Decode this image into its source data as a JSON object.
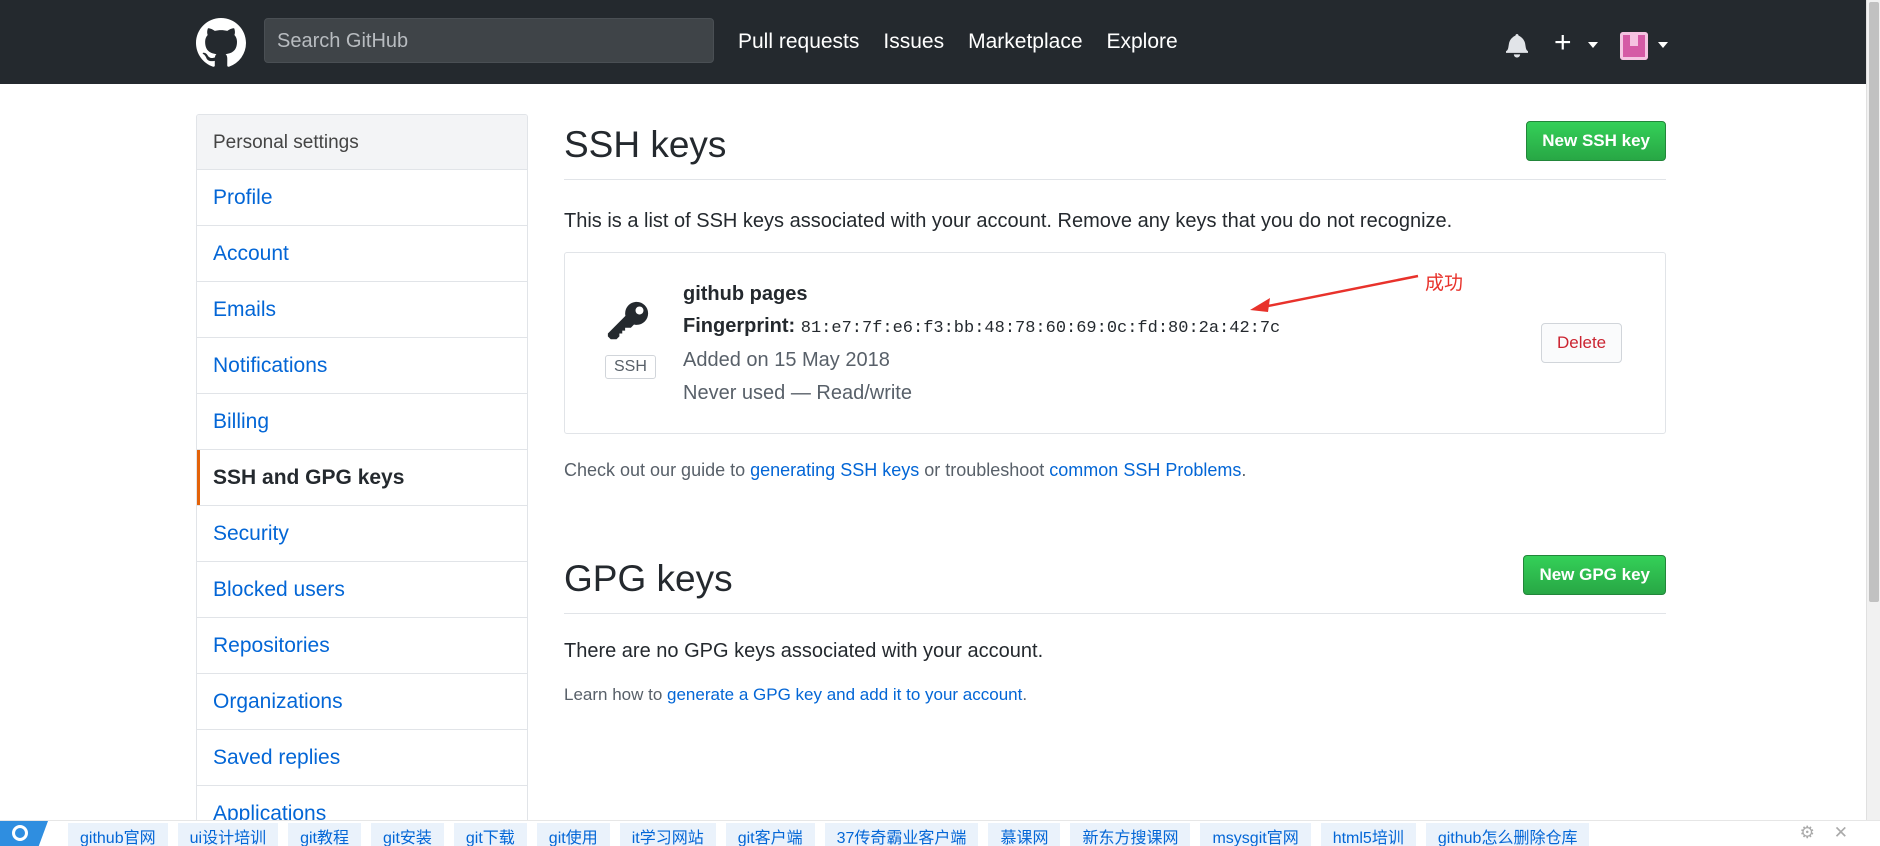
{
  "header": {
    "search_placeholder": "Search GitHub",
    "nav": [
      "Pull requests",
      "Issues",
      "Marketplace",
      "Explore"
    ],
    "plus_label": "+"
  },
  "sidebar": {
    "heading": "Personal settings",
    "items": [
      {
        "label": "Profile",
        "active": false
      },
      {
        "label": "Account",
        "active": false
      },
      {
        "label": "Emails",
        "active": false
      },
      {
        "label": "Notifications",
        "active": false
      },
      {
        "label": "Billing",
        "active": false
      },
      {
        "label": "SSH and GPG keys",
        "active": true
      },
      {
        "label": "Security",
        "active": false
      },
      {
        "label": "Blocked users",
        "active": false
      },
      {
        "label": "Repositories",
        "active": false
      },
      {
        "label": "Organizations",
        "active": false
      },
      {
        "label": "Saved replies",
        "active": false
      },
      {
        "label": "Applications",
        "active": false
      }
    ]
  },
  "ssh": {
    "title": "SSH keys",
    "new_button": "New SSH key",
    "description": "This is a list of SSH keys associated with your account. Remove any keys that you do not recognize.",
    "key": {
      "badge": "SSH",
      "name": "github pages",
      "fingerprint_label": "Fingerprint:",
      "fingerprint": "81:e7:7f:e6:f3:bb:48:78:60:69:0c:fd:80:2a:42:7c",
      "added": "Added on 15 May 2018",
      "usage": "Never used — Read/write",
      "delete_button": "Delete"
    },
    "annotation": "成功",
    "guide_prefix": "Check out our guide to ",
    "guide_link1": "generating SSH keys",
    "guide_mid": " or troubleshoot ",
    "guide_link2": "common SSH Problems",
    "guide_suffix": "."
  },
  "gpg": {
    "title": "GPG keys",
    "new_button": "New GPG key",
    "empty_text": "There are no GPG keys associated with your account.",
    "learn_prefix": "Learn how to ",
    "learn_link": "generate a GPG key and add it to your account",
    "learn_suffix": "."
  },
  "bookmarks": [
    "github官网",
    "ui设计培训",
    "git教程",
    "git安装",
    "git下载",
    "git使用",
    "it学习网站",
    "git客户端",
    "37传奇霸业客户端",
    "慕课网",
    "新东方搜课网",
    "msysgit官网",
    "html5培训",
    "github怎么删除仓库"
  ],
  "colors": {
    "accent": "#e36209",
    "link": "#0366d6",
    "green": "#28a745",
    "danger": "#cb2431",
    "header": "#24292e"
  }
}
